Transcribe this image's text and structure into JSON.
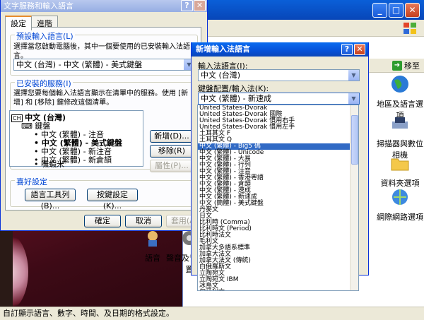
{
  "desktop": {
    "status_text": "自訂顯示語言、數字、時間、及日期的格式設定。"
  },
  "control_panel": {
    "go_label": "移至",
    "items": [
      {
        "label": "地區及語言選項",
        "icon": "globe-icon"
      },
      {
        "label": "掃描器與數位相機",
        "icon": "scanner-icon"
      },
      {
        "label": "資料夾選項",
        "icon": "folder-icon"
      },
      {
        "label": "網際網路選項",
        "icon": "internet-icon"
      },
      {
        "label": "語音",
        "icon": "speech-icon"
      },
      {
        "label": "聲音及音訊裝置",
        "icon": "speaker-icon"
      }
    ]
  },
  "main_dialog": {
    "title": "文字服務和輸入語言",
    "help": "?",
    "tabs": [
      "設定",
      "進階"
    ],
    "default_group": {
      "label": "預設輸入語言(L)",
      "description": "選擇當您啟動電腦後，其中一個要使用的已安裝輸入法語言。",
      "selected": "中文 (台灣) - 中文 (繁體) - 美式鍵盤"
    },
    "services_group": {
      "label": "已安裝的服務(I)",
      "description": "選擇您要每個輸入法語言顯示在清單中的服務。使用 [新增] 和 [移除] 鍵修改這個清單。",
      "tree": {
        "language": "中文 (台灣)",
        "category": "鍵盤",
        "items": [
          "中文 (繁體) - 注音",
          "中文 (繁體) - 美式鍵盤",
          "中文 (繁體) - 新注音",
          "中文 (繁體) - 新倉頡",
          "嘸蝦米"
        ],
        "selected_index": 1
      },
      "buttons": {
        "add": "新增(D)...",
        "remove": "移除(R)",
        "properties": "屬性(P)..."
      }
    },
    "preferences_group": {
      "label": "喜好設定",
      "buttons": {
        "language_bar": "語言工具列(B)...",
        "key_settings": "按鍵設定(K)..."
      }
    },
    "footer": {
      "ok": "確定",
      "cancel": "取消",
      "apply": "套用(A)"
    }
  },
  "add_dialog": {
    "title": "新增輸入法語言",
    "help": "?",
    "close": "✕",
    "input_language_label": "輸入法語言(I):",
    "input_language_value": "中文 (台灣)",
    "layout_label": "鍵盤配置/輸入法(K):",
    "layout_value": "中文 (繁體) - 新速成",
    "options": [
      "United States-Dvorak",
      "United States-Dvorak 國際",
      "United States-Dvorak 慣用右手",
      "United States-Dvorak 慣用左手",
      "土耳其文 F",
      "土耳其文 Q",
      "中文 (繁體) - Big5 碼",
      "中文 (繁體) - Unicode",
      "中文 (繁體) - 大易",
      "中文 (繁體) - 行列",
      "中文 (繁體) - 注音",
      "中文 (繁體) - 香港粵語",
      "中文 (繁體) - 倉頡",
      "中文 (繁體) - 速成",
      "中文 (繁體) - 新速成",
      "中文 (簡體) - 美式鍵盤",
      "丹麥文",
      "日文",
      "比利時 (Comma)",
      "比利時文 (Period)",
      "比利時法文",
      "毛利文",
      "加拿大多語系標準",
      "加拿大法文",
      "加拿大法文 (傳統)",
      "白俄羅斯文",
      "立陶宛文",
      "立陶宛文 IBM",
      "冰島文",
      "匈牙利文"
    ],
    "selected_index": 6
  }
}
